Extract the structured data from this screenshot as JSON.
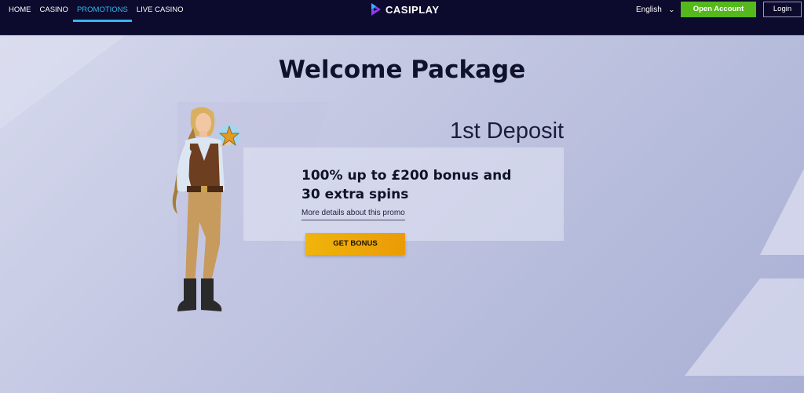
{
  "nav": {
    "items": [
      {
        "label": "HOME",
        "active": false
      },
      {
        "label": "CASINO",
        "active": false
      },
      {
        "label": "PROMOTIONS",
        "active": true
      },
      {
        "label": "LIVE CASINO",
        "active": false
      }
    ]
  },
  "brand": {
    "logo_text": "CASIPLAY"
  },
  "header": {
    "language": "English",
    "open_account_label": "Open Account",
    "login_label": "Login"
  },
  "hero": {
    "title": "Welcome Package",
    "deposit_label": "1st Deposit",
    "offer_line1": "100% up to £200 bonus and",
    "offer_line2": "30 extra spins",
    "details_link": "More details about this promo",
    "cta_label": "GET BONUS"
  },
  "colors": {
    "topbar": "#0c0b2e",
    "active_nav": "#35b7f0",
    "open_account": "#55b81c",
    "cta": "#f0b40c",
    "text_dark": "#10122b"
  },
  "icons": {
    "logo": "casiplay-logo-icon",
    "language_toggle": "chevron-down-icon"
  }
}
